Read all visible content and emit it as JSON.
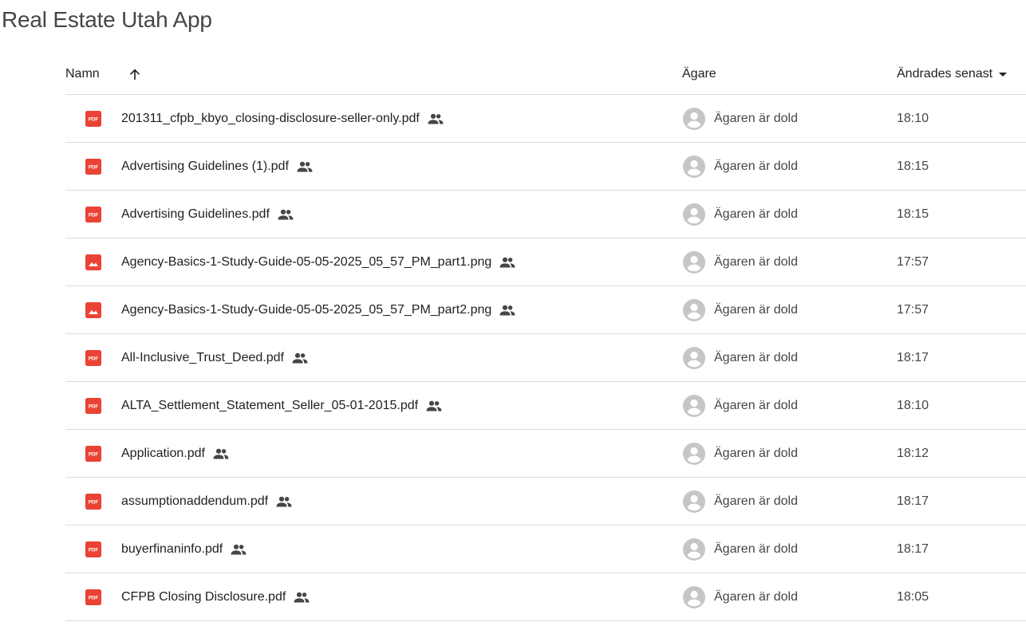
{
  "page": {
    "title": "Real Estate Utah App"
  },
  "header": {
    "name": "Namn",
    "owner": "Ägare",
    "modified": "Ändrades senast"
  },
  "colors": {
    "pdf_red": "#ea4335",
    "text": "#1f1f1f",
    "muted": "#444746",
    "divider": "#dadce0",
    "avatar": "#c4c7c5"
  },
  "files": [
    {
      "name": "201311_cfpb_kbyo_closing-disclosure-seller-only.pdf",
      "type": "pdf",
      "shared": true,
      "owner": "Ägaren är dold",
      "modified": "18:10"
    },
    {
      "name": "Advertising Guidelines (1).pdf",
      "type": "pdf",
      "shared": true,
      "owner": "Ägaren är dold",
      "modified": "18:15"
    },
    {
      "name": "Advertising Guidelines.pdf",
      "type": "pdf",
      "shared": true,
      "owner": "Ägaren är dold",
      "modified": "18:15"
    },
    {
      "name": "Agency-Basics-1-Study-Guide-05-05-2025_05_57_PM_part1.png",
      "type": "image",
      "shared": true,
      "owner": "Ägaren är dold",
      "modified": "17:57"
    },
    {
      "name": "Agency-Basics-1-Study-Guide-05-05-2025_05_57_PM_part2.png",
      "type": "image",
      "shared": true,
      "owner": "Ägaren är dold",
      "modified": "17:57"
    },
    {
      "name": "All-Inclusive_Trust_Deed.pdf",
      "type": "pdf",
      "shared": true,
      "owner": "Ägaren är dold",
      "modified": "18:17"
    },
    {
      "name": "ALTA_Settlement_Statement_Seller_05-01-2015.pdf",
      "type": "pdf",
      "shared": true,
      "owner": "Ägaren är dold",
      "modified": "18:10"
    },
    {
      "name": "Application.pdf",
      "type": "pdf",
      "shared": true,
      "owner": "Ägaren är dold",
      "modified": "18:12"
    },
    {
      "name": "assumptionaddendum.pdf",
      "type": "pdf",
      "shared": true,
      "owner": "Ägaren är dold",
      "modified": "18:17"
    },
    {
      "name": "buyerfinaninfo.pdf",
      "type": "pdf",
      "shared": true,
      "owner": "Ägaren är dold",
      "modified": "18:17"
    },
    {
      "name": "CFPB Closing Disclosure.pdf",
      "type": "pdf",
      "shared": true,
      "owner": "Ägaren är dold",
      "modified": "18:05"
    }
  ]
}
